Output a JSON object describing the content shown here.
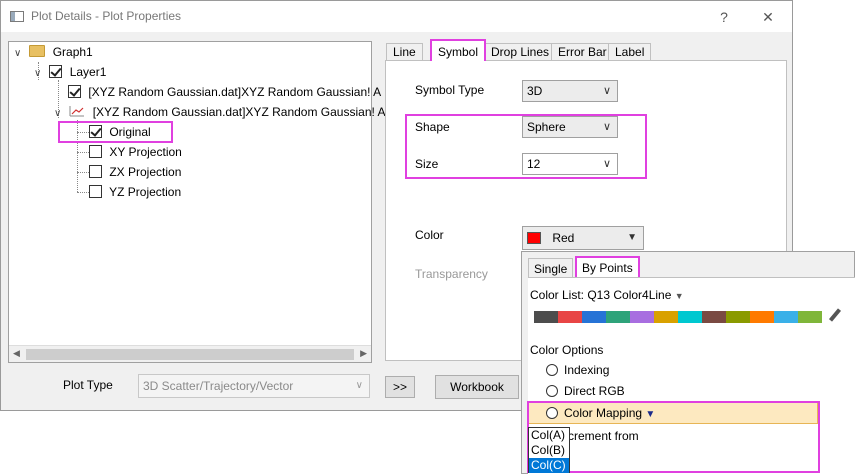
{
  "window": {
    "title": "Plot Details - Plot Properties",
    "help_label": "?",
    "close_label": "✕"
  },
  "tree": {
    "graph": "Graph1",
    "layer": "Layer1",
    "plot1": "[XYZ Random Gaussian.dat]XYZ Random Gaussian! A",
    "plot2": "[XYZ Random Gaussian.dat]XYZ Random Gaussian! A",
    "children": [
      "Original",
      "XY Projection",
      "ZX Projection",
      "YZ Projection"
    ]
  },
  "bottom": {
    "plot_type_label": "Plot Type",
    "plot_type_value": "3D Scatter/Trajectory/Vector",
    "expand_label": ">>",
    "workbook_label": "Workbook"
  },
  "tabs": [
    "Line",
    "Symbol",
    "Drop Lines",
    "Error Bar",
    "Label"
  ],
  "symbol": {
    "type_label": "Symbol Type",
    "type_value": "3D",
    "shape_label": "Shape",
    "shape_value": "Sphere",
    "size_label": "Size",
    "size_value": "12",
    "color_label": "Color",
    "color_value": "Red",
    "transparency_label": "Transparency"
  },
  "popup": {
    "tabs": [
      "Single",
      "By Points"
    ],
    "color_list_label": "Color List: Q13 Color4Line",
    "palette": [
      "#4d4d4d",
      "#e84545",
      "#2673d6",
      "#2ea37a",
      "#a86ee0",
      "#d9a100",
      "#00c8d0",
      "#7a4a42",
      "#8a9a00",
      "#ff7a00",
      "#3ab0e8",
      "#7fb63a"
    ],
    "color_options_label": "Color Options",
    "options": [
      "Indexing",
      "Direct RGB",
      "Color Mapping"
    ],
    "increment_text": "crement from",
    "dropdown_items": [
      "Col(A)",
      "Col(B)",
      "Col(C)"
    ]
  }
}
